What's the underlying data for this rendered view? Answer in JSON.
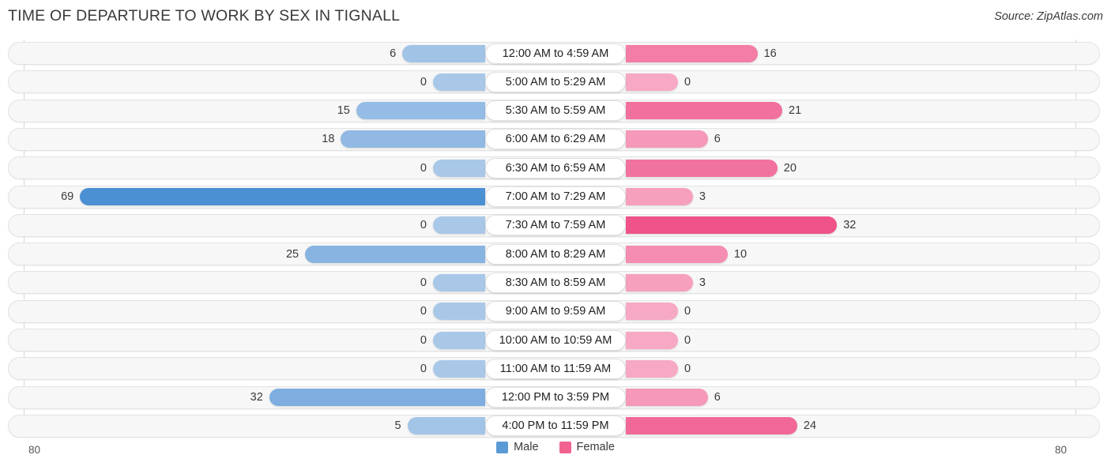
{
  "header": {
    "title": "TIME OF DEPARTURE TO WORK BY SEX IN TIGNALL",
    "source": "Source: ZipAtlas.com"
  },
  "axis": {
    "left_max_label": "80",
    "right_max_label": "80",
    "max": 80
  },
  "legend": {
    "items": [
      {
        "label": "Male",
        "color": "#5b9bd5"
      },
      {
        "label": "Female",
        "color": "#f2628f"
      }
    ]
  },
  "colors": {
    "male_min": "#a9c8e8",
    "male_max": "#4b8fd4",
    "female_min": "#f7a8c4",
    "female_max": "#ee4d85",
    "track": "#f7f7f7",
    "gridline": "#d8d8d8"
  },
  "chart_data": {
    "type": "bar",
    "orientation": "horizontal-diverging",
    "title": "Time of Departure to Work by Sex in Tignall",
    "xlabel": "",
    "ylabel": "",
    "xlim": [
      80,
      80
    ],
    "grid": true,
    "legend_position": "bottom-center",
    "categories": [
      "12:00 AM to 4:59 AM",
      "5:00 AM to 5:29 AM",
      "5:30 AM to 5:59 AM",
      "6:00 AM to 6:29 AM",
      "6:30 AM to 6:59 AM",
      "7:00 AM to 7:29 AM",
      "7:30 AM to 7:59 AM",
      "8:00 AM to 8:29 AM",
      "8:30 AM to 8:59 AM",
      "9:00 AM to 9:59 AM",
      "10:00 AM to 10:59 AM",
      "11:00 AM to 11:59 AM",
      "12:00 PM to 3:59 PM",
      "4:00 PM to 11:59 PM"
    ],
    "series": [
      {
        "name": "Male",
        "values": [
          6,
          0,
          15,
          18,
          0,
          69,
          0,
          25,
          0,
          0,
          0,
          0,
          32,
          5
        ]
      },
      {
        "name": "Female",
        "values": [
          16,
          0,
          21,
          6,
          20,
          3,
          32,
          10,
          3,
          0,
          0,
          0,
          6,
          24
        ]
      }
    ]
  }
}
